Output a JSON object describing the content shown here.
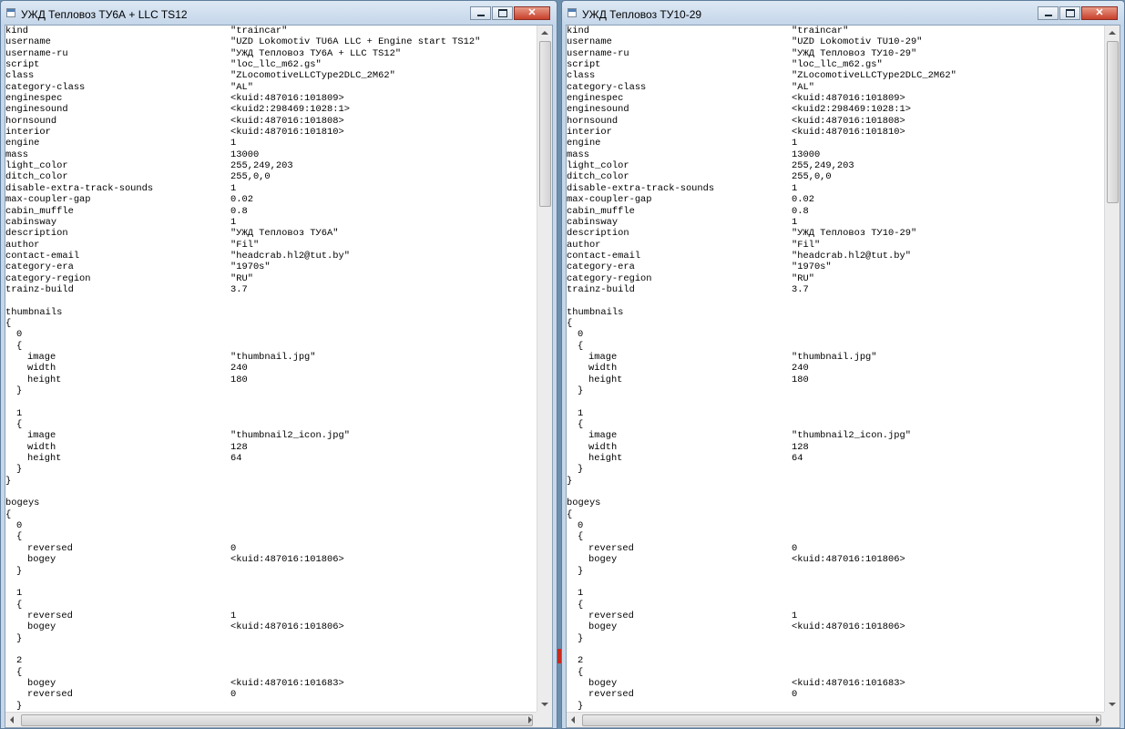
{
  "windows": [
    {
      "title": "УЖД Тепловоз ТУ6А + LLC TS12",
      "lines": [
        {
          "key": "kind",
          "value": "\"traincar\""
        },
        {
          "key": "username",
          "value": "\"UZD Lokomotiv TU6A LLC + Engine start TS12\""
        },
        {
          "key": "username-ru",
          "value": "\"УЖД Тепловоз ТУ6А + LLC TS12\""
        },
        {
          "key": "script",
          "value": "\"loc_llc_m62.gs\""
        },
        {
          "key": "class",
          "value": "\"ZLocomotiveLLCType2DLC_2M62\""
        },
        {
          "key": "category-class",
          "value": "\"AL\""
        },
        {
          "key": "enginespec",
          "value": "<kuid:487016:101809>"
        },
        {
          "key": "enginesound",
          "value": "<kuid2:298469:1028:1>"
        },
        {
          "key": "hornsound",
          "value": "<kuid:487016:101808>"
        },
        {
          "key": "interior",
          "value": "<kuid:487016:101810>"
        },
        {
          "key": "engine",
          "value": "1"
        },
        {
          "key": "mass",
          "value": "13000"
        },
        {
          "key": "light_color",
          "value": "255,249,203"
        },
        {
          "key": "ditch_color",
          "value": "255,0,0"
        },
        {
          "key": "disable-extra-track-sounds",
          "value": "1"
        },
        {
          "key": "max-coupler-gap",
          "value": "0.02"
        },
        {
          "key": "cabin_muffle",
          "value": "0.8"
        },
        {
          "key": "cabinsway",
          "value": "1"
        },
        {
          "key": "description",
          "value": "\"УЖД Тепловоз ТУ6А\""
        },
        {
          "key": "author",
          "value": "\"Fil\""
        },
        {
          "key": "contact-email",
          "value": "\"headcrab.hl2@tut.by\""
        },
        {
          "key": "category-era",
          "value": "\"1970s\""
        },
        {
          "key": "category-region",
          "value": "\"RU\""
        },
        {
          "key": "trainz-build",
          "value": "3.7"
        },
        {
          "key": "",
          "value": ""
        },
        {
          "key": "thumbnails",
          "value": ""
        },
        {
          "key": "{",
          "value": ""
        },
        {
          "key": "  0",
          "value": ""
        },
        {
          "key": "  {",
          "value": ""
        },
        {
          "key": "    image",
          "value": "\"thumbnail.jpg\""
        },
        {
          "key": "    width",
          "value": "240"
        },
        {
          "key": "    height",
          "value": "180"
        },
        {
          "key": "  }",
          "value": ""
        },
        {
          "key": "",
          "value": ""
        },
        {
          "key": "  1",
          "value": ""
        },
        {
          "key": "  {",
          "value": ""
        },
        {
          "key": "    image",
          "value": "\"thumbnail2_icon.jpg\""
        },
        {
          "key": "    width",
          "value": "128"
        },
        {
          "key": "    height",
          "value": "64"
        },
        {
          "key": "  }",
          "value": ""
        },
        {
          "key": "}",
          "value": ""
        },
        {
          "key": "",
          "value": ""
        },
        {
          "key": "bogeys",
          "value": ""
        },
        {
          "key": "{",
          "value": ""
        },
        {
          "key": "  0",
          "value": ""
        },
        {
          "key": "  {",
          "value": ""
        },
        {
          "key": "    reversed",
          "value": "0"
        },
        {
          "key": "    bogey",
          "value": "<kuid:487016:101806>"
        },
        {
          "key": "  }",
          "value": ""
        },
        {
          "key": "",
          "value": ""
        },
        {
          "key": "  1",
          "value": ""
        },
        {
          "key": "  {",
          "value": ""
        },
        {
          "key": "    reversed",
          "value": "1"
        },
        {
          "key": "    bogey",
          "value": "<kuid:487016:101806>"
        },
        {
          "key": "  }",
          "value": ""
        },
        {
          "key": "",
          "value": ""
        },
        {
          "key": "  2",
          "value": ""
        },
        {
          "key": "  {",
          "value": ""
        },
        {
          "key": "    bogey",
          "value": "<kuid:487016:101683>"
        },
        {
          "key": "    reversed",
          "value": "0"
        },
        {
          "key": "  }",
          "value": ""
        }
      ]
    },
    {
      "title": "УЖД Тепловоз ТУ10-29",
      "lines": [
        {
          "key": "kind",
          "value": "\"traincar\""
        },
        {
          "key": "username",
          "value": "\"UZD Lokomotiv TU10-29\""
        },
        {
          "key": "username-ru",
          "value": "\"УЖД Тепловоз ТУ10-29\""
        },
        {
          "key": "script",
          "value": "\"loc_llc_m62.gs\""
        },
        {
          "key": "class",
          "value": "\"ZLocomotiveLLCType2DLC_2M62\""
        },
        {
          "key": "category-class",
          "value": "\"AL\""
        },
        {
          "key": "enginespec",
          "value": "<kuid:487016:101809>"
        },
        {
          "key": "enginesound",
          "value": "<kuid2:298469:1028:1>"
        },
        {
          "key": "hornsound",
          "value": "<kuid:487016:101808>"
        },
        {
          "key": "interior",
          "value": "<kuid:487016:101810>"
        },
        {
          "key": "engine",
          "value": "1"
        },
        {
          "key": "mass",
          "value": "13000"
        },
        {
          "key": "light_color",
          "value": "255,249,203"
        },
        {
          "key": "ditch_color",
          "value": "255,0,0"
        },
        {
          "key": "disable-extra-track-sounds",
          "value": "1"
        },
        {
          "key": "max-coupler-gap",
          "value": "0.02"
        },
        {
          "key": "cabin_muffle",
          "value": "0.8"
        },
        {
          "key": "cabinsway",
          "value": "1"
        },
        {
          "key": "description",
          "value": "\"УЖД Тепловоз ТУ10-29\""
        },
        {
          "key": "author",
          "value": "\"Fil\""
        },
        {
          "key": "contact-email",
          "value": "\"headcrab.hl2@tut.by\""
        },
        {
          "key": "category-era",
          "value": "\"1970s\""
        },
        {
          "key": "category-region",
          "value": "\"RU\""
        },
        {
          "key": "trainz-build",
          "value": "3.7"
        },
        {
          "key": "",
          "value": ""
        },
        {
          "key": "thumbnails",
          "value": ""
        },
        {
          "key": "{",
          "value": ""
        },
        {
          "key": "  0",
          "value": ""
        },
        {
          "key": "  {",
          "value": ""
        },
        {
          "key": "    image",
          "value": "\"thumbnail.jpg\""
        },
        {
          "key": "    width",
          "value": "240"
        },
        {
          "key": "    height",
          "value": "180"
        },
        {
          "key": "  }",
          "value": ""
        },
        {
          "key": "",
          "value": ""
        },
        {
          "key": "  1",
          "value": ""
        },
        {
          "key": "  {",
          "value": ""
        },
        {
          "key": "    image",
          "value": "\"thumbnail2_icon.jpg\""
        },
        {
          "key": "    width",
          "value": "128"
        },
        {
          "key": "    height",
          "value": "64"
        },
        {
          "key": "  }",
          "value": ""
        },
        {
          "key": "}",
          "value": ""
        },
        {
          "key": "",
          "value": ""
        },
        {
          "key": "bogeys",
          "value": ""
        },
        {
          "key": "{",
          "value": ""
        },
        {
          "key": "  0",
          "value": ""
        },
        {
          "key": "  {",
          "value": ""
        },
        {
          "key": "    reversed",
          "value": "0"
        },
        {
          "key": "    bogey",
          "value": "<kuid:487016:101806>"
        },
        {
          "key": "  }",
          "value": ""
        },
        {
          "key": "",
          "value": ""
        },
        {
          "key": "  1",
          "value": ""
        },
        {
          "key": "  {",
          "value": ""
        },
        {
          "key": "    reversed",
          "value": "1"
        },
        {
          "key": "    bogey",
          "value": "<kuid:487016:101806>"
        },
        {
          "key": "  }",
          "value": ""
        },
        {
          "key": "",
          "value": ""
        },
        {
          "key": "  2",
          "value": ""
        },
        {
          "key": "  {",
          "value": ""
        },
        {
          "key": "    bogey",
          "value": "<kuid:487016:101683>"
        },
        {
          "key": "    reversed",
          "value": "0"
        },
        {
          "key": "  }",
          "value": ""
        }
      ]
    }
  ],
  "icons": {
    "app": "notepad-icon",
    "minimize": "minimize-icon",
    "maximize": "maximize-icon",
    "close": "close-icon"
  },
  "colors": {
    "desktop": "#6d8fae",
    "frame": "#c6d7ea",
    "close_button": "#c8402b",
    "text": "#000000"
  }
}
